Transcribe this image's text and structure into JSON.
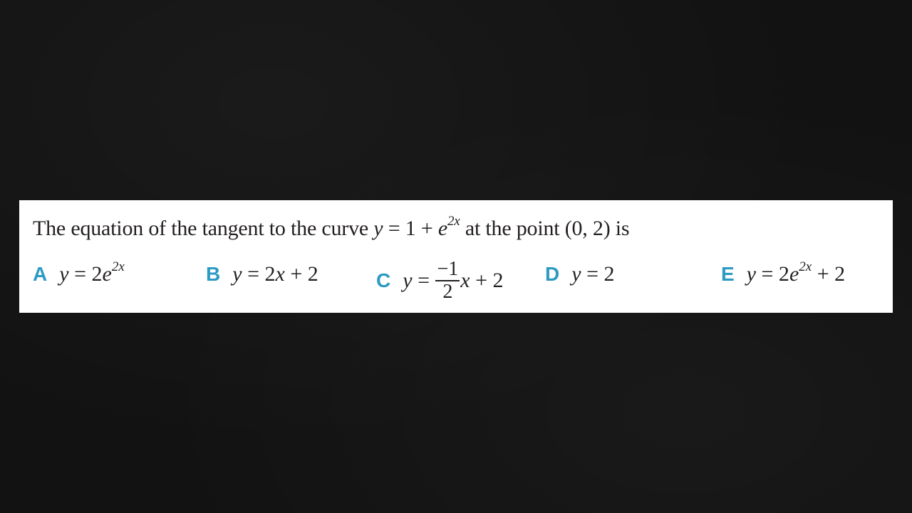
{
  "question": {
    "prefix": "The equation of the tangent to the curve ",
    "curve_lhs": "y",
    "curve_eq": " = 1 + ",
    "curve_base": "e",
    "curve_exp": "2x",
    "suffix": " at the point (0, 2) is"
  },
  "options": [
    {
      "letter": "A",
      "lhs": "y",
      "rhs": " = 2",
      "base": "e",
      "exp": "2x"
    },
    {
      "letter": "B",
      "lhs": "y",
      "rhs_1": " = 2",
      "var": "x",
      "rhs_2": " + 2"
    },
    {
      "letter": "C",
      "lhs": "y",
      "rhs_1": " = ",
      "frac_num": "−1",
      "frac_den": "2",
      "var": "x",
      "rhs_2": " + 2"
    },
    {
      "letter": "D",
      "lhs": "y",
      "rhs": " = 2"
    },
    {
      "letter": "E",
      "lhs": "y",
      "rhs_1": " = 2",
      "base": "e",
      "exp": "2x",
      "rhs_2": " + 2"
    }
  ],
  "colors": {
    "option_letter": "#2c9ac3",
    "panel_background": "#ffffff",
    "page_background": "#121212"
  }
}
